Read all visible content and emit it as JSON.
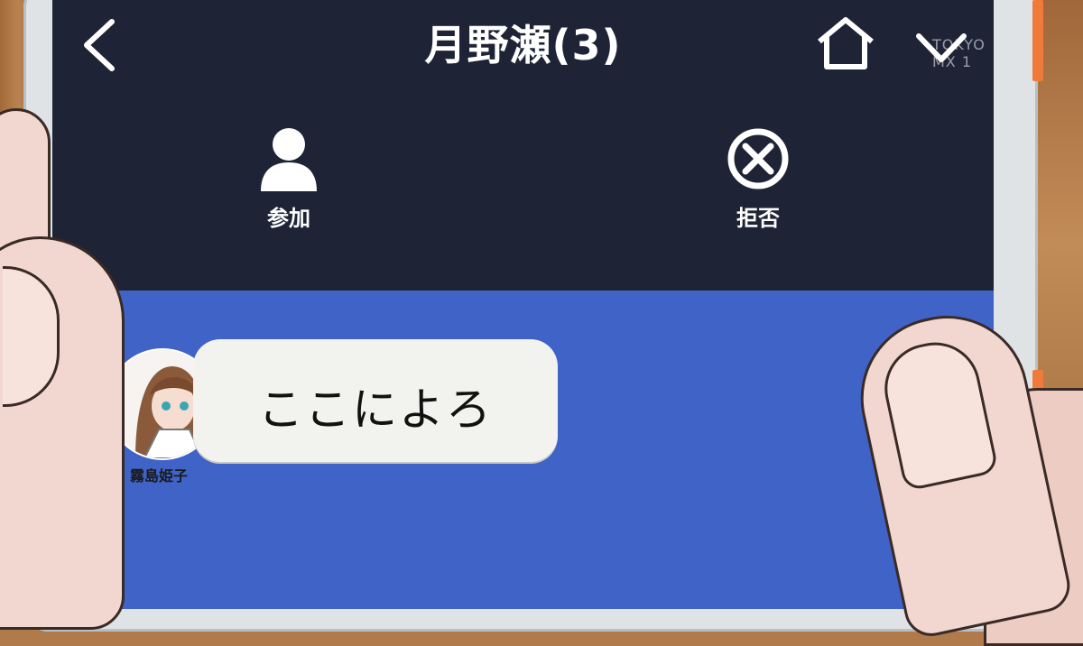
{
  "header": {
    "title": "月野瀬(3)",
    "back_icon": "chevron-left-icon",
    "home_icon": "home-icon",
    "menu_icon": "chevron-down-icon",
    "watermark": "TOKYO MX 1"
  },
  "actions": [
    {
      "label": "参加",
      "icon": "person-icon"
    },
    {
      "label": "拒否",
      "icon": "close-circle-icon"
    }
  ],
  "messages": [
    {
      "sender": "霧島姫子",
      "text": "ここによろ"
    }
  ],
  "colors": {
    "header_bg": "#1e2436",
    "chat_bg": "#3f63c7",
    "bubble_bg": "#f2f2ef",
    "accent_orange": "#f07a3a"
  }
}
